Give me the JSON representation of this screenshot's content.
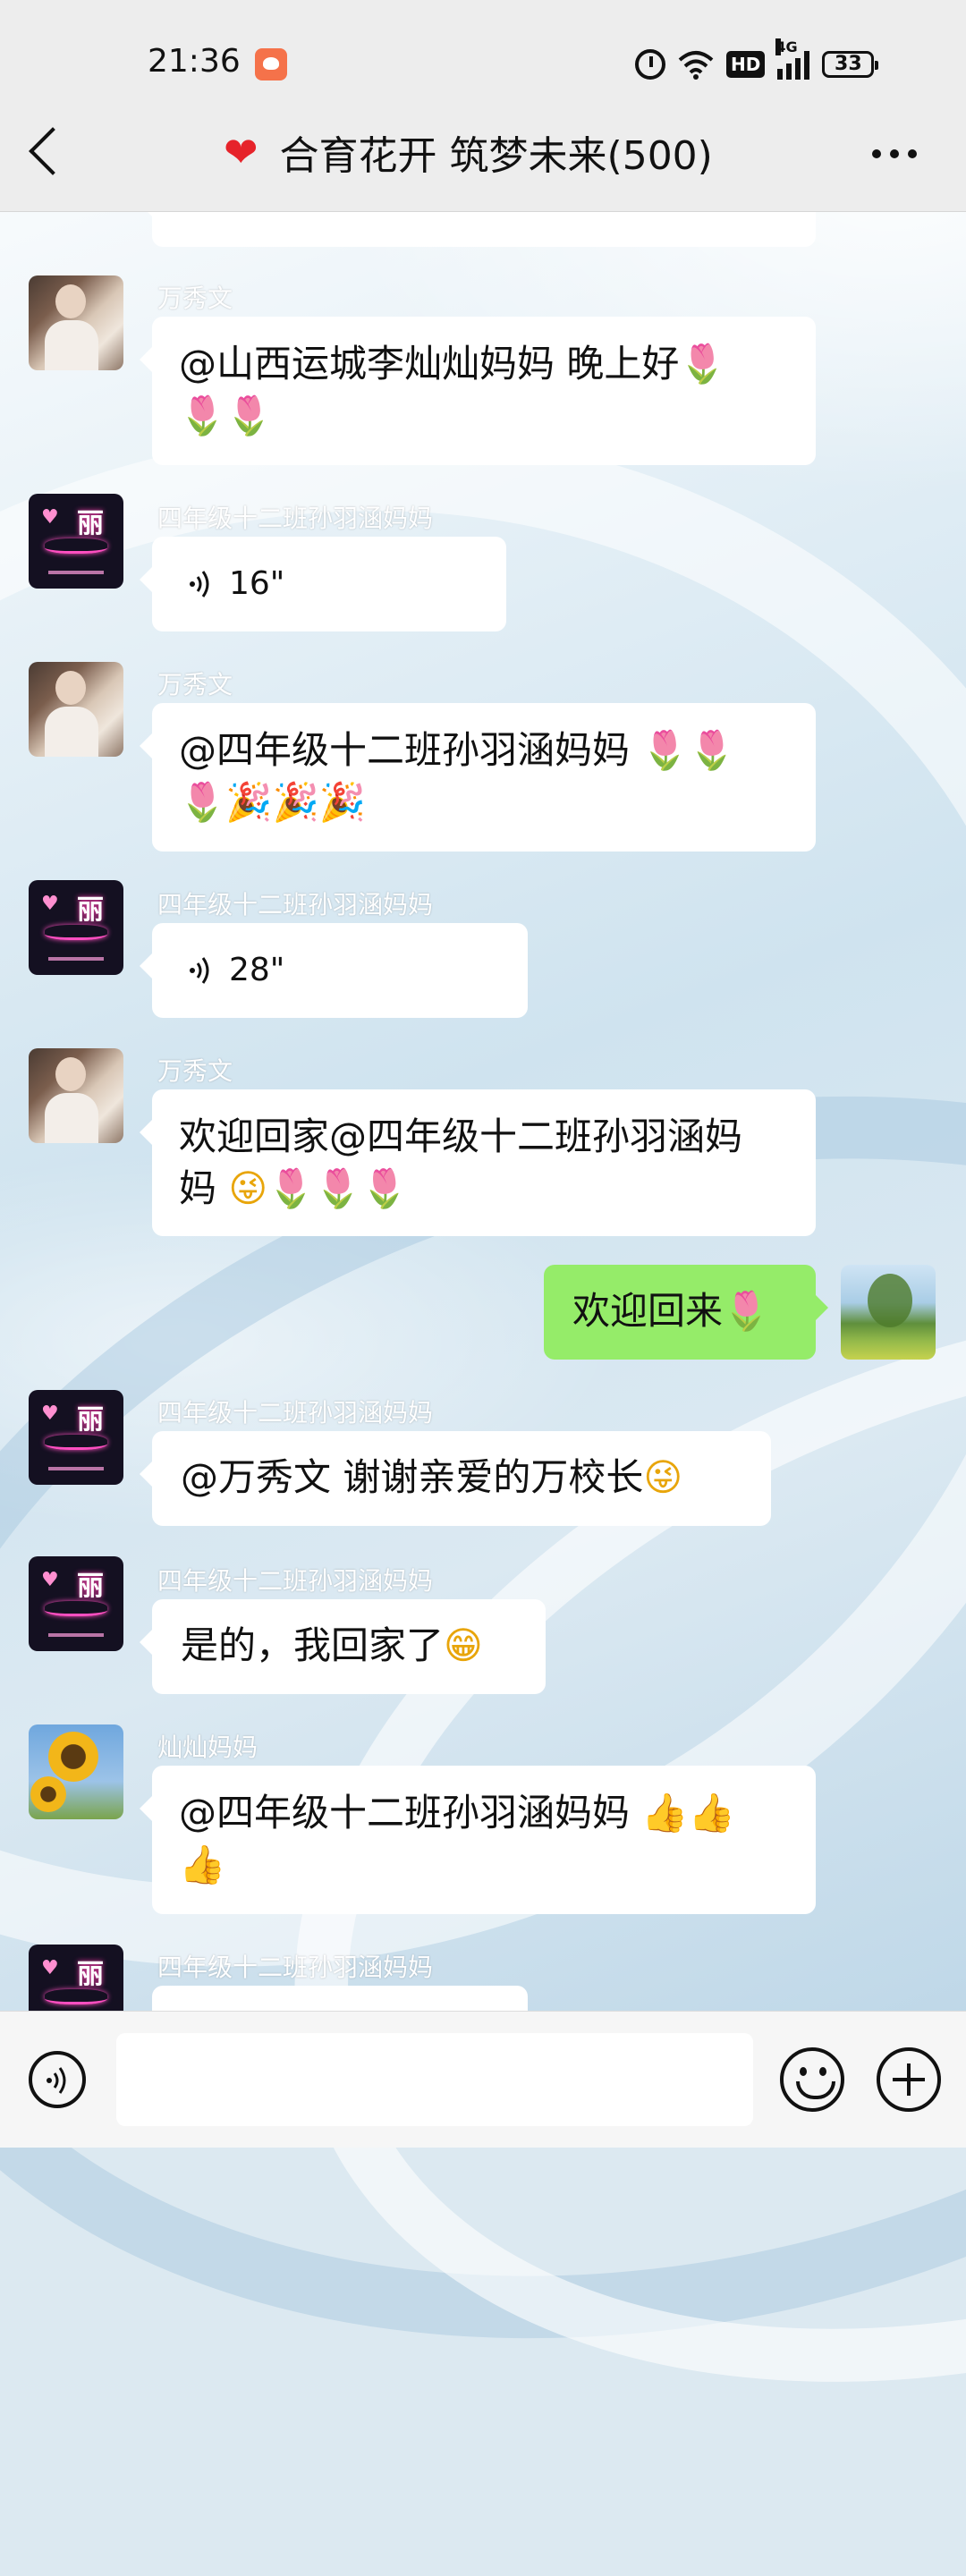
{
  "status_bar": {
    "time": "21:36",
    "battery": "33",
    "network": "4G",
    "hd": "HD"
  },
  "header": {
    "title": "合育花开 筑梦未来(500)",
    "heart": "❤"
  },
  "messages": [
    {
      "sender": "万秀文",
      "text": "@山西运城李灿灿妈妈  晚上好",
      "emoji_line1": "🌷",
      "emoji_line2": "🌷🌷"
    },
    {
      "sender": "四年级十二班孙羽涵妈妈",
      "voice_duration": "16\""
    },
    {
      "sender": "万秀文",
      "text": "@四年级十二班孙羽涵妈妈 ",
      "emoji_line1": "🌷🌷",
      "emoji_line2": "🌷🎉🎉🎉"
    },
    {
      "sender": "四年级十二班孙羽涵妈妈",
      "voice_duration": "28\""
    },
    {
      "sender": "万秀文",
      "text": "欢迎回家@四年级十二班孙羽涵妈",
      "line2_text": "妈 ",
      "emoji_line2": "😜🌷🌷🌷"
    },
    {
      "sender": "",
      "text": "欢迎回来",
      "emoji": "🌷"
    },
    {
      "sender": "四年级十二班孙羽涵妈妈",
      "text": "@万秀文  谢谢亲爱的万校长",
      "emoji": "😜"
    },
    {
      "sender": "四年级十二班孙羽涵妈妈",
      "text": "是的，我回家了",
      "emoji": "😁"
    },
    {
      "sender": "灿灿妈妈",
      "text": "@四年级十二班孙羽涵妈妈 ",
      "emoji_line1": "👍👍",
      "emoji_line2": "👍"
    },
    {
      "sender": "四年级十二班孙羽涵妈妈"
    }
  ],
  "input": {
    "placeholder": ""
  },
  "colors": {
    "my_bubble": "#95ec69",
    "other_bubble": "#ffffff",
    "topbar": "#ededed"
  }
}
